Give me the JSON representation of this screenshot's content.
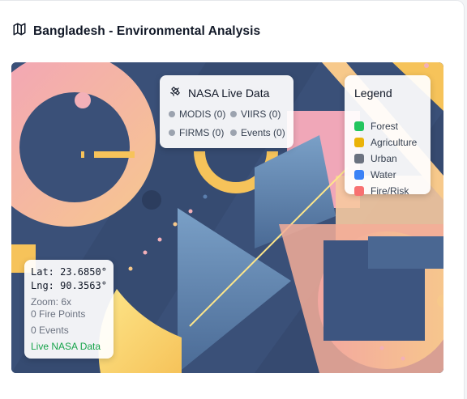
{
  "header": {
    "title": "Bangladesh - Environmental Analysis",
    "icon": "map-icon"
  },
  "nasa_panel": {
    "title": "NASA Live Data",
    "icon": "satellite-icon",
    "sources": [
      {
        "label": "MODIS (0)"
      },
      {
        "label": "VIIRS (0)"
      },
      {
        "label": "FIRMS (0)"
      },
      {
        "label": "Events (0)"
      }
    ]
  },
  "legend": {
    "title": "Legend",
    "items": [
      {
        "label": "Forest",
        "color": "#22c55e"
      },
      {
        "label": "Agriculture",
        "color": "#eab308"
      },
      {
        "label": "Urban",
        "color": "#6b7280"
      },
      {
        "label": "Water",
        "color": "#3b82f6"
      },
      {
        "label": "Fire/Risk",
        "color": "#f87171"
      }
    ]
  },
  "coords": {
    "lat": "Lat: 23.6850°",
    "lng": "Lng: 90.3563°",
    "zoom": "Zoom: 6x",
    "fire_points": "0 Fire Points",
    "events": "0 Events",
    "status": "Live NASA Data",
    "status_color": "#16a34a"
  }
}
